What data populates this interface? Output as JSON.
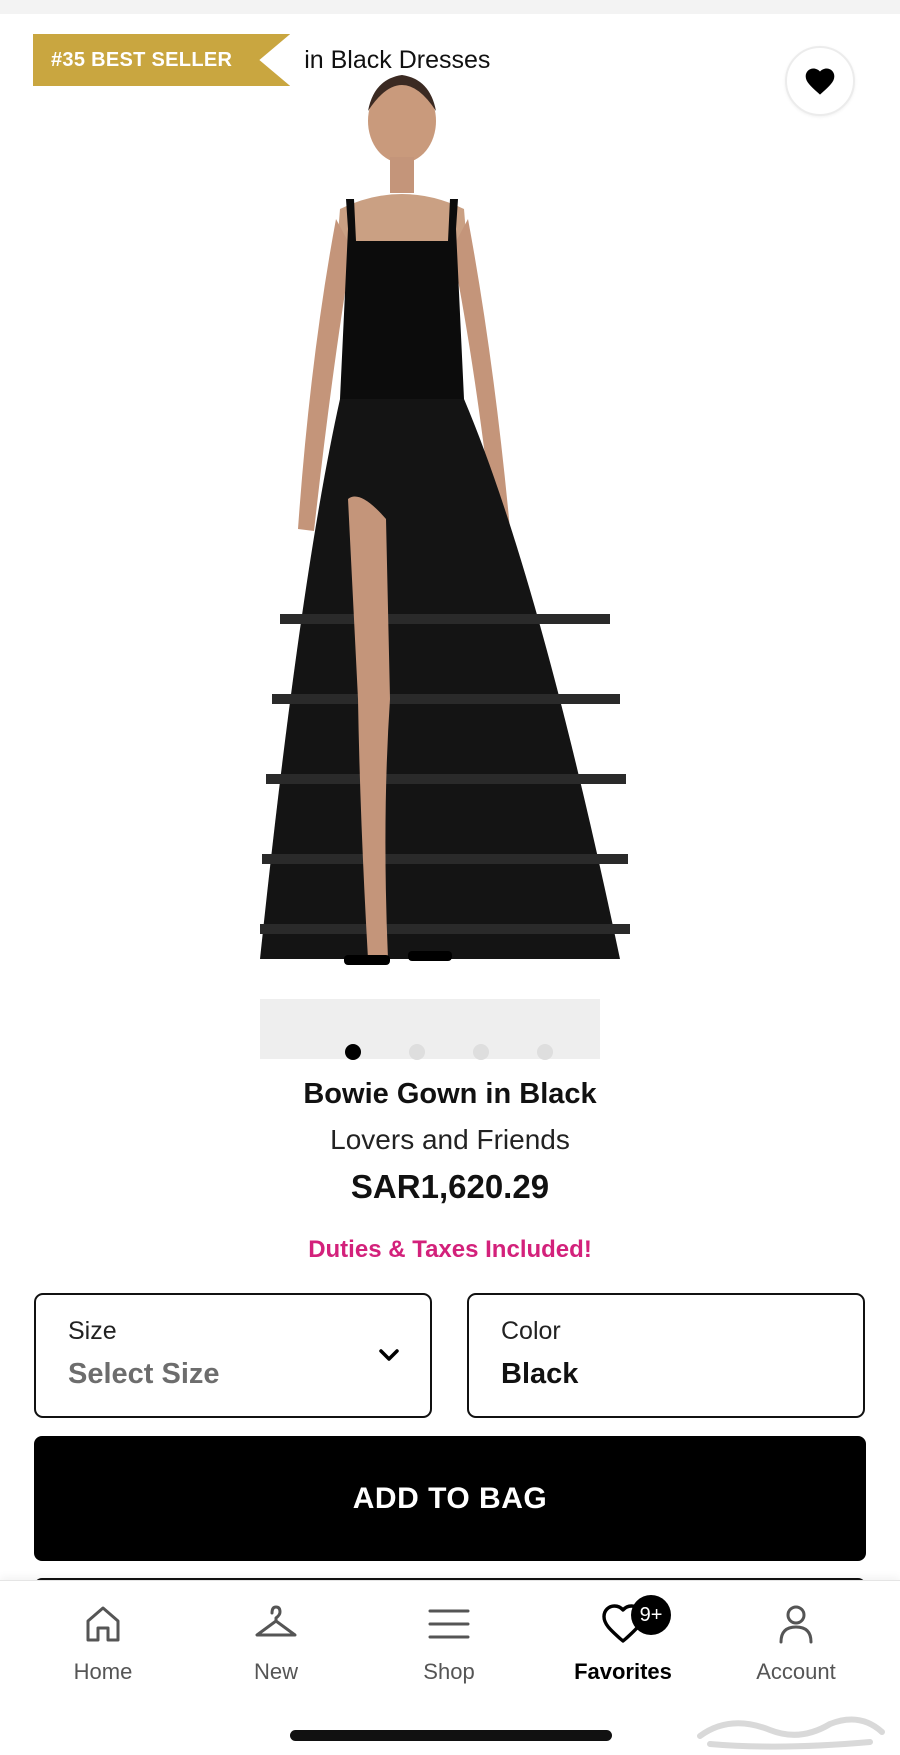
{
  "hero": {
    "badge_rank": "#35 BEST SELLER",
    "badge_text": "in Black Dresses",
    "image_count": 4,
    "active_image": 1
  },
  "product": {
    "title": "Bowie Gown in Black",
    "brand": "Lovers and Friends",
    "price": "SAR1,620.29",
    "duties": "Duties & Taxes Included!"
  },
  "options": {
    "size_label": "Size",
    "size_value": "Select Size",
    "color_label": "Color",
    "color_value": "Black"
  },
  "cta": {
    "add_to_bag": "ADD TO BAG"
  },
  "nav": {
    "items": [
      {
        "label": "Home",
        "icon": "home-icon"
      },
      {
        "label": "New",
        "icon": "hanger-icon"
      },
      {
        "label": "Shop",
        "icon": "menu-icon"
      },
      {
        "label": "Favorites",
        "icon": "heart-icon",
        "badge": "9+",
        "active": true
      },
      {
        "label": "Account",
        "icon": "user-icon"
      }
    ]
  },
  "colors": {
    "badge": "#c9a640",
    "duties": "#d3217b",
    "primary": "#000000"
  }
}
